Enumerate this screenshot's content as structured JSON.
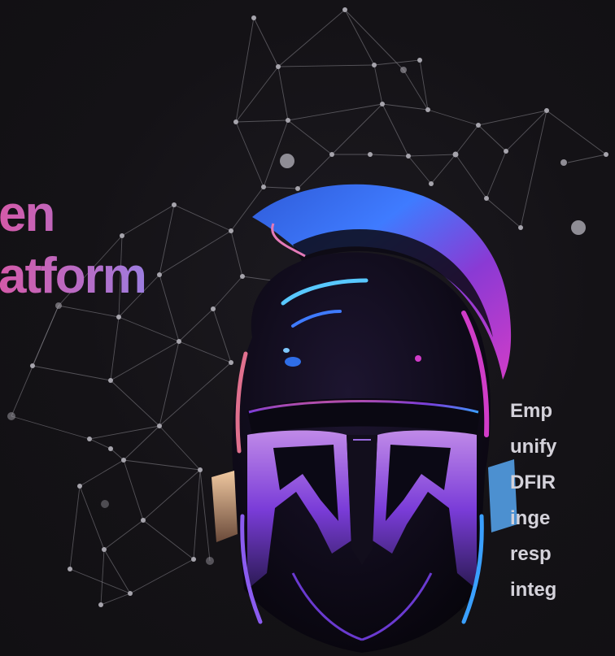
{
  "hero": {
    "headline_lines": [
      "en",
      "atform"
    ],
    "description_lines": [
      "Emp",
      "unify",
      "DFIR",
      "inge",
      "resp",
      "integ"
    ]
  },
  "illustration": {
    "icon": "spartan-helmet-icon",
    "network": "constellation-network-graphic"
  },
  "colors": {
    "background": "#131116",
    "headline_gradient_start": "#d45aa8",
    "headline_gradient_end": "#9c7ee0",
    "body_text": "#d4d2da",
    "helmet_blue": "#3f7bff",
    "helmet_magenta": "#d03cc8",
    "helmet_purple": "#7a3cd8",
    "network_lines": "#8a8890"
  }
}
